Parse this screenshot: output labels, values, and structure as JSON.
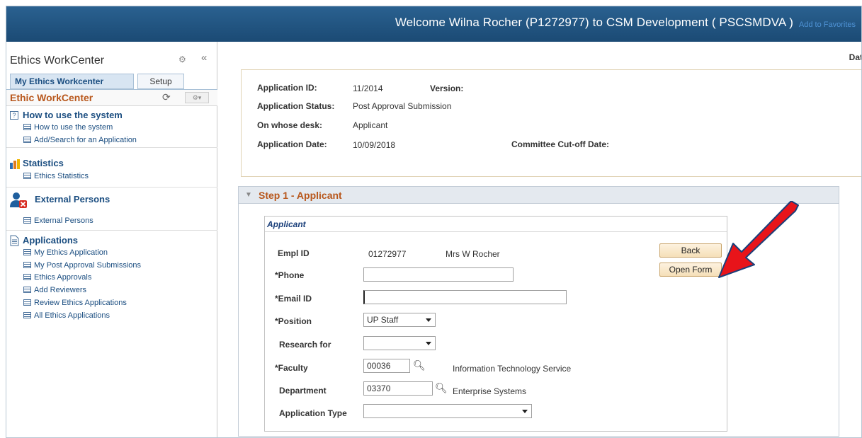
{
  "header": {
    "welcome": "Welcome Wilna Rocher (P1272977) to CSM Development ( PSCSMDVA )",
    "add_favorites": "Add to Favorites"
  },
  "sidebar": {
    "title": "Ethics WorkCenter",
    "collapse": "«",
    "tabs": [
      "My Ethics Workcenter",
      "Setup"
    ],
    "workcenter_title": "Ethic WorkCenter",
    "groups": [
      {
        "title": "How to use the system",
        "icon": "help-icon",
        "links": [
          "How to use the system",
          "Add/Search for an Application"
        ]
      },
      {
        "title": "Statistics",
        "icon": "bar-chart-icon",
        "links": [
          "Ethics Statistics"
        ]
      },
      {
        "title": "External Persons",
        "icon": "person-remove-icon",
        "links": [
          "External Persons"
        ]
      },
      {
        "title": "Applications",
        "icon": "document-icon",
        "links": [
          "My Ethics Application",
          "My Post Approval Submissions",
          "Ethics Approvals",
          "Add Reviewers",
          "Review Ethics Applications",
          "All Ethics Applications"
        ]
      }
    ]
  },
  "main": {
    "corner_text": "Dat",
    "info": {
      "application_id_label": "Application ID:",
      "application_id": "11/2014",
      "version_label": "Version:",
      "status_label": "Application Status:",
      "status": "Post Approval Submission",
      "desk_label": "On whose desk:",
      "desk": "Applicant",
      "date_label": "Application Date:",
      "date": "10/09/2018",
      "cutoff_label": "Committee Cut-off Date:"
    },
    "step_title": "Step 1 - Applicant",
    "applicant": {
      "title": "Applicant",
      "empl_id_label": "Empl ID",
      "empl_id": "01272977",
      "name": "Mrs W Rocher",
      "phone_label": "*Phone",
      "phone_value": "",
      "email_label": "*Email ID",
      "email_value": "",
      "position_label": "*Position",
      "position_value": "UP Staff",
      "research_label": "Research for",
      "research_value": "",
      "faculty_label": "*Faculty",
      "faculty_code": "00036",
      "faculty_name": "Information Technology Service",
      "department_label": "Department",
      "department_code": "03370",
      "department_name": "Enterprise Systems",
      "app_type_label": "Application Type",
      "app_type_value": ""
    },
    "buttons": {
      "back": "Back",
      "open_form": "Open Form"
    }
  },
  "colors": {
    "banner": "#1f5282",
    "accent_orange": "#b8571c",
    "link_blue": "#1a4d80",
    "arrow_red": "#e8141a"
  }
}
